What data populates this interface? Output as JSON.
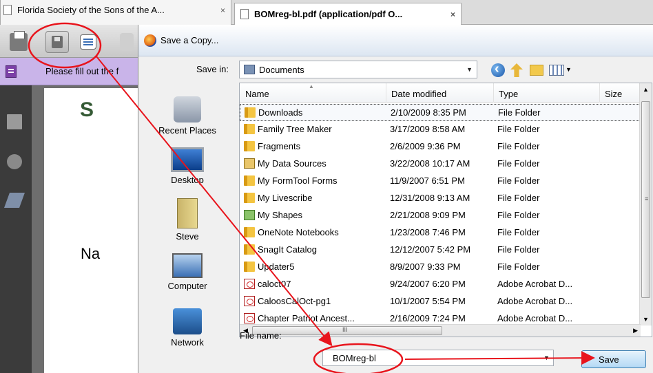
{
  "browser": {
    "tabs": [
      {
        "label": "Florida Society of the Sons of the A...",
        "close": "×"
      },
      {
        "label": "BOMreg-bl.pdf (application/pdf O...",
        "close": "×"
      }
    ]
  },
  "reader": {
    "fill_message": "Please fill out the f",
    "page_text": "Na",
    "seal_glyph": "S"
  },
  "dialog": {
    "title": "Save a Copy...",
    "save_in_label": "Save in:",
    "save_in_value": "Documents",
    "places": [
      {
        "label": "Recent Places",
        "icon": "recent-places-icon"
      },
      {
        "label": "Desktop",
        "icon": "desktop-icon"
      },
      {
        "label": "Steve",
        "icon": "user-folder-icon"
      },
      {
        "label": "Computer",
        "icon": "computer-icon"
      },
      {
        "label": "Network",
        "icon": "network-icon"
      }
    ],
    "columns": [
      "Name",
      "Date modified",
      "Type",
      "Size"
    ],
    "files": [
      {
        "name": "Downloads",
        "date": "2/10/2009 8:35 PM",
        "type": "File Folder",
        "icon": "folder-icon"
      },
      {
        "name": "Family Tree Maker",
        "date": "3/17/2009 8:58 AM",
        "type": "File Folder",
        "icon": "folder-icon"
      },
      {
        "name": "Fragments",
        "date": "2/6/2009 9:36 PM",
        "type": "File Folder",
        "icon": "folder-icon"
      },
      {
        "name": "My Data Sources",
        "date": "3/22/2008 10:17 AM",
        "type": "File Folder",
        "icon": "data-sources-icon"
      },
      {
        "name": "My FormTool Forms",
        "date": "11/9/2007 6:51 PM",
        "type": "File Folder",
        "icon": "folder-icon"
      },
      {
        "name": "My Livescribe",
        "date": "12/31/2008 9:13 AM",
        "type": "File Folder",
        "icon": "folder-icon"
      },
      {
        "name": "My Shapes",
        "date": "2/21/2008 9:09 PM",
        "type": "File Folder",
        "icon": "shapes-icon"
      },
      {
        "name": "OneNote Notebooks",
        "date": "1/23/2008 7:46 PM",
        "type": "File Folder",
        "icon": "folder-icon"
      },
      {
        "name": "SnagIt Catalog",
        "date": "12/12/2007 5:42 PM",
        "type": "File Folder",
        "icon": "folder-icon"
      },
      {
        "name": "Updater5",
        "date": "8/9/2007 9:33 PM",
        "type": "File Folder",
        "icon": "folder-icon"
      },
      {
        "name": "caloct07",
        "date": "9/24/2007 6:20 PM",
        "type": "Adobe Acrobat D...",
        "icon": "pdf-icon"
      },
      {
        "name": "CaloosCalOct-pg1",
        "date": "10/1/2007 5:54 PM",
        "type": "Adobe Acrobat D...",
        "icon": "pdf-icon"
      },
      {
        "name": "Chapter Patriot Ancest...",
        "date": "2/16/2009 7:24 PM",
        "type": "Adobe Acrobat D...",
        "icon": "pdf-icon"
      }
    ],
    "file_name_label": "File name:",
    "file_name_value": "BOMreg-bl",
    "save_label": "Save",
    "scroll_grip": "III",
    "scroll_grip_v": "≡"
  },
  "colors": {
    "annotation": "#e8141c",
    "purple_bar": "#c9b4e9",
    "selection_border": "#333333"
  }
}
